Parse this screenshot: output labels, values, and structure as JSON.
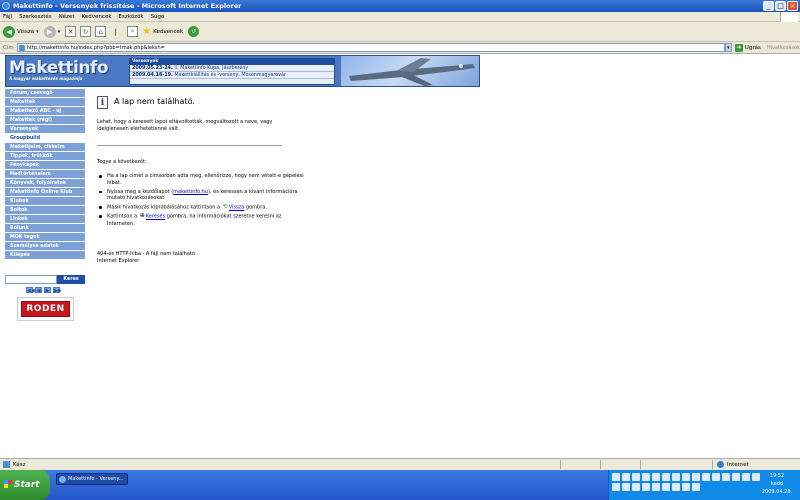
{
  "window": {
    "title": "Makettinfo - Versenyek frissítése - Microsoft Internet Explorer"
  },
  "menu": [
    "Fájl",
    "Szerkesztés",
    "Nézet",
    "Kedvencek",
    "Eszközök",
    "Súgó"
  ],
  "toolbar": {
    "back_label": "Vissza",
    "favorites_label": "Kedvencek"
  },
  "address": {
    "label": "Cím",
    "url": "http://makettinfo.hu/index.php?pbb=tmak.php&leksh=",
    "go_label": "Ugrás",
    "links_label": "Hivatkozások"
  },
  "header": {
    "logo_name": "Makettinfo",
    "logo_tagline": "A magyar makettezés magazinja",
    "news_title": "Versenyek",
    "news": [
      {
        "date": "2009.05.23-24.",
        "num": "II.",
        "text": "Makettinfo Kupa, Jászberény"
      },
      {
        "date": "2009.04.18-19.",
        "num": "",
        "text": "Makettkiállítás és -verseny, Mosonmagyaróvár"
      }
    ]
  },
  "sidebar": {
    "items": [
      {
        "label": "Fórum, csevegő",
        "active": false
      },
      {
        "label": "Makettek",
        "active": false
      },
      {
        "label": "Makettező ABC - új",
        "active": false
      },
      {
        "label": "Makettek (régi)",
        "active": false
      },
      {
        "label": "Versenyek",
        "active": false
      },
      {
        "label": "Groupbuild",
        "active": true
      },
      {
        "label": "Makettjeim, cikkeim",
        "active": false
      },
      {
        "label": "Tippek, trükkök",
        "active": false
      },
      {
        "label": "Fényképek",
        "active": false
      },
      {
        "label": "Hadtörténelem",
        "active": false
      },
      {
        "label": "Könyvek, folyóiratok",
        "active": false
      },
      {
        "label": "Makettinfo Online Klub",
        "active": false
      },
      {
        "label": "Klubok",
        "active": false
      },
      {
        "label": "Boltok",
        "active": false
      },
      {
        "label": "Linkek",
        "active": false
      },
      {
        "label": "Rólunk",
        "active": false
      },
      {
        "label": "MOK tagok",
        "active": false
      },
      {
        "label": "Személyes adatok",
        "active": false
      },
      {
        "label": "Kilépés",
        "active": false
      }
    ],
    "search_button": "Keres",
    "pager": [
      "◀◀",
      "◀",
      "▶",
      "▶▶"
    ],
    "sponsor": "RODEN"
  },
  "error": {
    "title": "A lap nem található.",
    "intro": "Lehet, hogy a keresett lapot eltávolították, megváltozott a neve, vagy ideiglenesen elérhetetlenné vált.",
    "tegye": "Tegye a következőt:",
    "b1": "Ha a lap címét a címsorban adta meg, ellenőrizze, hogy nem vétett-e gépelési hibát.",
    "b2_pre": "Nyissa meg a kezdőlapot (",
    "b2_link": "makettinfo.hu",
    "b2_post": "), és keressen a kívánt információra mutató hivatkozásokat.",
    "b3_pre": "Másik hivatkozás kipróbálásához kattintson a ",
    "b3_link": "Vissza",
    "b3_post": " gombra.",
    "b4_pre": "Kattintson a ",
    "b4_link": "Keresés",
    "b4_post": " gombra, ha információkat szeretne keresni az Interneten.",
    "footer1": "404-es HTTP-hiba - A fájl nem található",
    "footer2": "Internet Explorer"
  },
  "status": {
    "text": "Kész",
    "zone": "Internet"
  },
  "taskbar": {
    "start": "Start",
    "app": "Makettinfo - Verseny...",
    "clock_time": "19:52",
    "clock_day": "kedd",
    "clock_date": "2009.04.28."
  }
}
